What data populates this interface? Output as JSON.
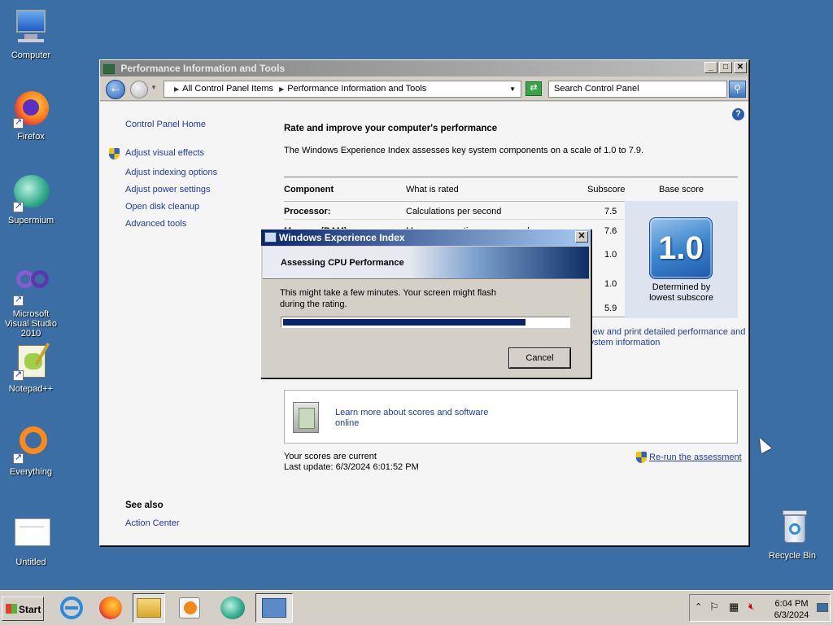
{
  "desktop": {
    "icons": [
      {
        "label": "Computer"
      },
      {
        "label": "Firefox"
      },
      {
        "label": "Supermium"
      },
      {
        "label": "Microsoft Visual Studio 2010"
      },
      {
        "label": "Notepad++"
      },
      {
        "label": "Everything"
      },
      {
        "label": "Untitled"
      },
      {
        "label": "Recycle Bin"
      }
    ]
  },
  "window": {
    "title": "Performance Information and Tools",
    "address": {
      "crumb1": "All Control Panel Items",
      "crumb2": "Performance Information and Tools"
    },
    "search_placeholder": "Search Control Panel",
    "left_nav": {
      "home": "Control Panel Home",
      "items": [
        "Adjust visual effects",
        "Adjust indexing options",
        "Adjust power settings",
        "Open disk cleanup",
        "Advanced tools"
      ],
      "see_also_title": "See also",
      "see_also_item": "Action Center"
    },
    "main": {
      "heading": "Rate and improve your computer's performance",
      "intro": "The Windows Experience Index assesses key system components on a scale of 1.0 to 7.9.",
      "table": {
        "headers": {
          "component": "Component",
          "rated": "What is rated",
          "subscore": "Subscore",
          "base": "Base score"
        },
        "rows": [
          {
            "component": "Processor:",
            "rated": "Calculations per second",
            "subscore": "7.5"
          },
          {
            "component": "Memory (RAM):",
            "rated": "Memory operations per second",
            "subscore": "7.6"
          },
          {
            "component": "",
            "rated": "",
            "subscore": "1.0"
          },
          {
            "component": "",
            "rated": "",
            "subscore": "1.0"
          },
          {
            "component": "",
            "rated": "",
            "subscore": "5.9"
          }
        ],
        "base_score": "1.0",
        "base_caption_line1": "Determined by",
        "base_caption_line2": "lowest subscore"
      },
      "view_print_line1": "View and print detailed performance and",
      "view_print_line2": "system information",
      "learn_line1": "Learn more about scores and software",
      "learn_line2": "online",
      "scores_current": "Your scores are current",
      "last_update": "Last update: 6/3/2024 6:01:52 PM",
      "rerun": "Re-run the assessment"
    }
  },
  "dialog": {
    "title": "Windows Experience Index",
    "banner": "Assessing CPU Performance",
    "message_line1": "This might take a few minutes. Your screen might flash",
    "message_line2": "during the rating.",
    "progress_fraction": 0.85,
    "cancel_label": "Cancel"
  },
  "taskbar": {
    "start_label": "Start",
    "time": "6:04 PM",
    "date": "6/3/2024"
  }
}
